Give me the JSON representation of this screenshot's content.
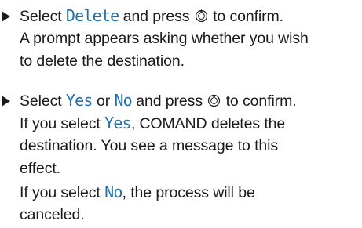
{
  "step1": {
    "prefix": "Select ",
    "keyword": "Delete",
    "mid": " and press ",
    "button_icon": "controller-press-icon",
    "suffix": " to confirm.",
    "line2": "A prompt appears asking whether you wish",
    "line3": "to delete the destination."
  },
  "step2": {
    "prefix": "Select ",
    "keyword_yes": "Yes",
    "or_text": " or ",
    "keyword_no": "No",
    "mid": " and press ",
    "button_icon": "controller-press-icon",
    "suffix": " to confirm.",
    "para1_prefix": "If you select ",
    "para1_keyword": "Yes",
    "para1_suffix": ", COMAND deletes the",
    "para1_line2": "destination. You see a message to this",
    "para1_line3": "effect.",
    "para2_prefix": "If you select ",
    "para2_keyword": "No",
    "para2_suffix": ", the process will be",
    "para2_line2": "canceled."
  },
  "colors": {
    "keyword": "#1f6fae",
    "text": "#1a1a1a"
  }
}
